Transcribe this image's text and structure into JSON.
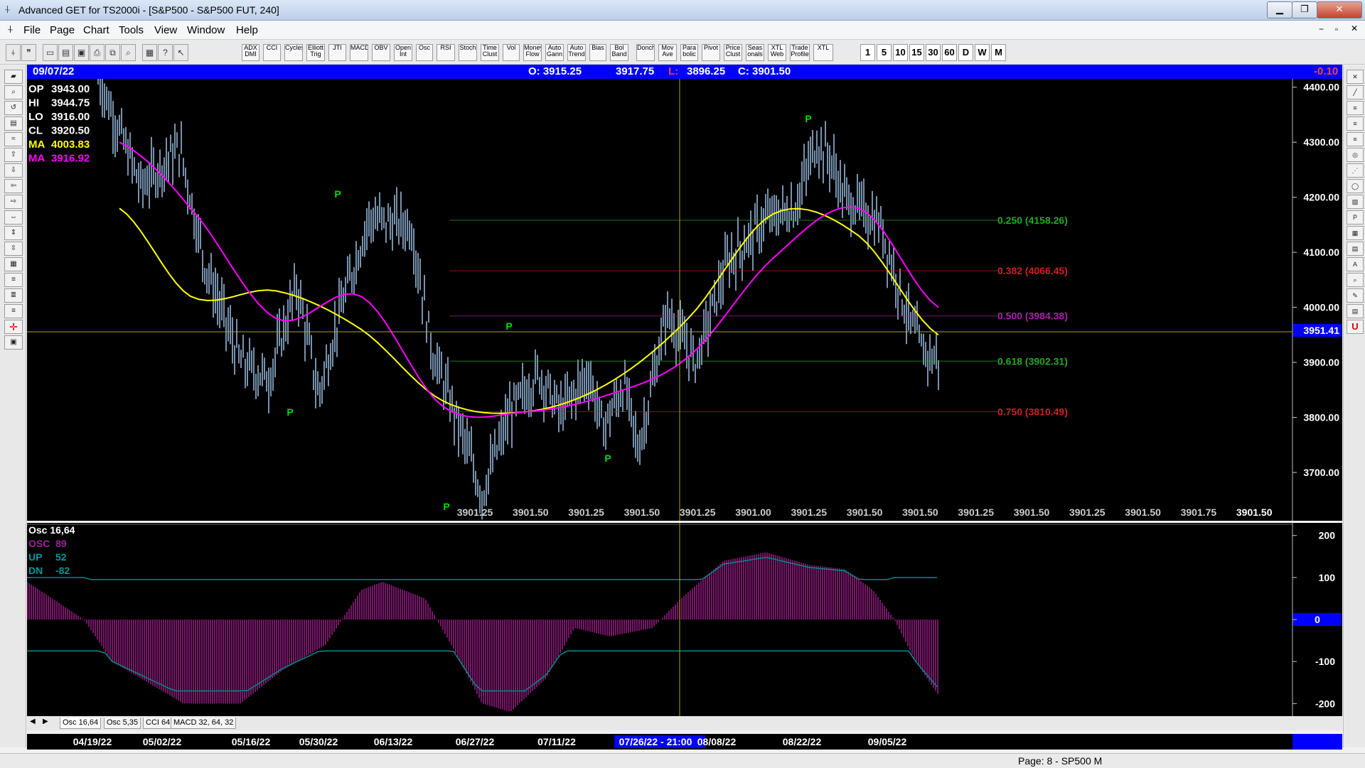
{
  "window": {
    "title": "Advanced GET for TS2000i - [S&P500 - S&P500 FUT, 240]"
  },
  "menu": [
    "File",
    "Page",
    "Chart",
    "Tools",
    "View",
    "Window",
    "Help"
  ],
  "toolbar": {
    "indicators": [
      "ADX DMI",
      "CCI",
      "Cycles",
      "Elliott Trig",
      "JTI",
      "MACD",
      "OBV",
      "Open Int",
      "Osc",
      "RSI",
      "Stoch",
      "Time Clust",
      "Vol",
      "Money Flow",
      "Auto Gann",
      "Auto Trend",
      "Bias",
      "Bol Band",
      "Donch",
      "Mov Ave",
      "Para bolic",
      "Pivot",
      "Price Clust",
      "Seas onals",
      "XTL Web",
      "Trade Profile",
      "XTL"
    ],
    "intervals": [
      "1",
      "5",
      "10",
      "15",
      "30",
      "60",
      "D",
      "W",
      "M"
    ]
  },
  "infobar": {
    "date": "09/07/22",
    "open": "O: 3915.25",
    "high": "3917.75",
    "low_label": "L:",
    "low": "3896.25",
    "close": "C: 3901.50",
    "change": "-0.10"
  },
  "legend": [
    {
      "label": "OP",
      "value": "3943.00",
      "color": "#ffffff"
    },
    {
      "label": "HI",
      "value": "3944.75",
      "color": "#ffffff"
    },
    {
      "label": "LO",
      "value": "3916.00",
      "color": "#ffffff"
    },
    {
      "label": "CL",
      "value": "3920.50",
      "color": "#ffffff"
    },
    {
      "label": "MA",
      "value": "4003.83",
      "color": "#ffff00"
    },
    {
      "label": "MA",
      "value": "3916.92",
      "color": "#ff00ff"
    }
  ],
  "price_axis": {
    "labels": [
      "4400.00",
      "4300.00",
      "4200.00",
      "4100.00",
      "4000.00",
      "3900.00",
      "3800.00",
      "3700.00"
    ],
    "current": "3951.41"
  },
  "fib_levels": [
    {
      "text": "0.250 (4158.26)",
      "color": "#22aa22"
    },
    {
      "text": "0.382 (4066.45)",
      "color": "#cc2222"
    },
    {
      "text": "0.500 (3984.38)",
      "color": "#aa22aa"
    },
    {
      "text": "0.618 (3902.31)",
      "color": "#22aa22"
    },
    {
      "text": "0.750 (3810.49)",
      "color": "#cc2222"
    }
  ],
  "projection_labels": [
    "3901.25",
    "3901.50",
    "3901.25",
    "3901.50",
    "3901.25",
    "3901.00",
    "3901.25",
    "3901.50",
    "3901.50",
    "3901.25",
    "3901.50",
    "3901.25",
    "3901.50",
    "3901.75",
    "3901.50"
  ],
  "pivot_marker": "P",
  "oscillator": {
    "title": "Osc 16,64",
    "lines": [
      {
        "label": "OSC",
        "value": "89",
        "color": "#a020a0"
      },
      {
        "label": "UP",
        "value": "52",
        "color": "#009999"
      },
      {
        "label": "DN",
        "value": "-82",
        "color": "#009999"
      }
    ],
    "axis": [
      "200",
      "100",
      "0",
      "-100",
      "-200"
    ]
  },
  "tabs": [
    "Osc 16,64",
    "Osc 5,35",
    "CCI 64",
    "MACD 32, 64, 32"
  ],
  "dates": [
    "04/19/22",
    "05/02/22",
    "05/16/22",
    "05/30/22",
    "06/13/22",
    "06/27/22",
    "07/11/22",
    "07/26/22 - 21:00",
    "08/08/22",
    "08/22/22",
    "09/05/22"
  ],
  "status": {
    "page": "Page: 8 - SP500 M"
  },
  "chart_data": {
    "type": "line",
    "x": [
      "04/19/22",
      "05/02/22",
      "05/16/22",
      "05/30/22",
      "06/13/22",
      "06/27/22",
      "07/11/22",
      "07/26/22",
      "08/08/22",
      "08/22/22",
      "09/05/22"
    ],
    "series": [
      {
        "name": "MA",
        "values": [
          4180,
          4020,
          4030,
          3960,
          3830,
          3810,
          3860,
          3980,
          4170,
          4130,
          3950
        ]
      },
      {
        "name": "MA",
        "values": [
          4300,
          4180,
          3980,
          4020,
          3820,
          3810,
          3840,
          3910,
          4090,
          4180,
          4000
        ]
      }
    ],
    "ylim": [
      3620,
      4410
    ]
  }
}
